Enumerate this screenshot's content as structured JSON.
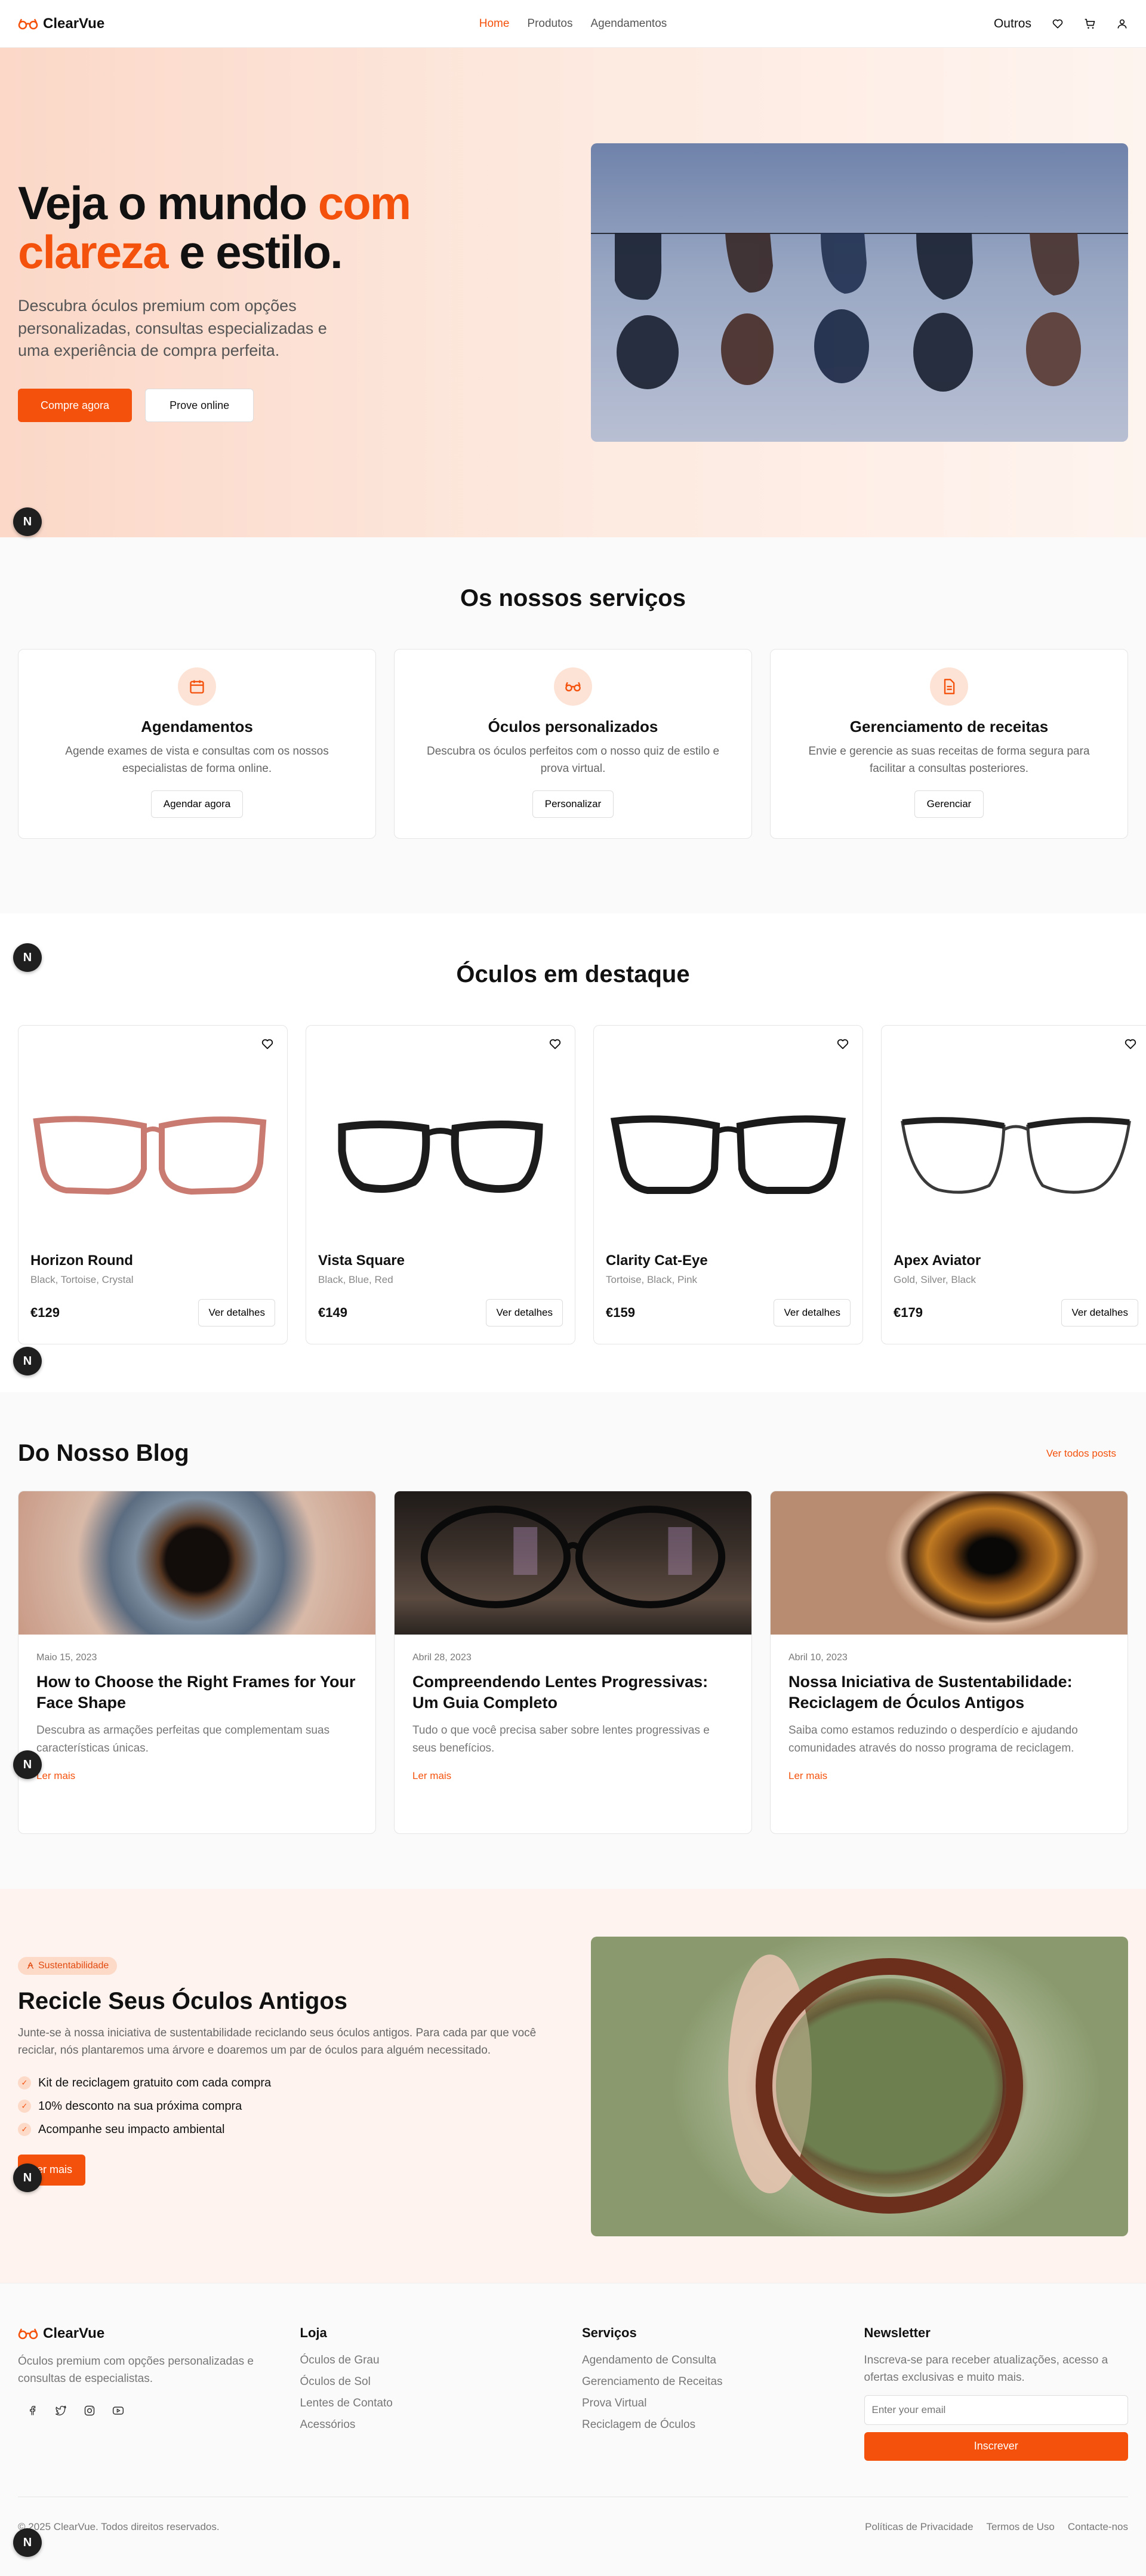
{
  "brand": {
    "name": "ClearVue",
    "accent": "#f4520c"
  },
  "nav": {
    "items": [
      {
        "label": "Home",
        "active": true
      },
      {
        "label": "Produtos",
        "active": false
      },
      {
        "label": "Agendamentos",
        "active": false
      }
    ]
  },
  "header_right": {
    "others_label": "Outros"
  },
  "hero": {
    "title_part1": "Veja o mundo ",
    "title_accent": "com clareza",
    "title_part2": " e estilo.",
    "subtitle": "Descubra óculos premium com opções personalizadas, consultas especializadas e uma experiência de compra perfeita.",
    "primary_btn": "Compre agora",
    "secondary_btn": "Prove online"
  },
  "badge_letter": "N",
  "services": {
    "title": "Os nossos serviços",
    "items": [
      {
        "icon": "calendar-icon",
        "title": "Agendamentos",
        "desc": "Agende exames de vista e consultas com os nossos especialistas de forma online.",
        "btn": "Agendar agora"
      },
      {
        "icon": "glasses-icon",
        "title": "Óculos personalizados",
        "desc": "Descubra os óculos perfeitos com o nosso quiz de estilo e prova virtual.",
        "btn": "Personalizar"
      },
      {
        "icon": "document-icon",
        "title": "Gerenciamento de receitas",
        "desc": "Envie e gerencie as suas receitas de forma segura para facilitar a consultas posteriores.",
        "btn": "Gerenciar"
      }
    ]
  },
  "products": {
    "title": "Óculos em destaque",
    "items": [
      {
        "name": "Horizon Round",
        "colors": "Black, Tortoise, Crystal",
        "price": "€129",
        "btn": "Ver detalhes",
        "frame_color": "#c97b72"
      },
      {
        "name": "Vista Square",
        "colors": "Black, Blue, Red",
        "price": "€149",
        "btn": "Ver detalhes",
        "frame_color": "#1c1c1c"
      },
      {
        "name": "Clarity Cat-Eye",
        "colors": "Tortoise, Black, Pink",
        "price": "€159",
        "btn": "Ver detalhes",
        "frame_color": "#1a1a1a"
      },
      {
        "name": "Apex Aviator",
        "colors": "Gold, Silver, Black",
        "price": "€179",
        "btn": "Ver detalhes",
        "frame_color": "#3a3a3a"
      }
    ]
  },
  "blog": {
    "title": "Do Nosso Blog",
    "all_link": "Ver todos posts",
    "posts": [
      {
        "date": "Maio 15, 2023",
        "title": "How to Choose the Right Frames for Your Face Shape",
        "excerpt": "Descubra as armações perfeitas que complementam suas características únicas.",
        "read": "Ler mais"
      },
      {
        "date": "Abril 28, 2023",
        "title": "Compreendendo Lentes Progressivas: Um Guia Completo",
        "excerpt": "Tudo o que você precisa saber sobre lentes progressivas e seus benefícios.",
        "read": "Ler mais"
      },
      {
        "date": "Abril 10, 2023",
        "title": "Nossa Iniciativa de Sustentabilidade: Reciclagem de Óculos Antigos",
        "excerpt": "Saiba como estamos reduzindo o desperdício e ajudando comunidades através do nosso programa de reciclagem.",
        "read": "Ler mais"
      }
    ]
  },
  "recycle": {
    "tag": "Sustentabilidade",
    "title": "Recicle Seus Óculos Antigos",
    "desc": "Junte-se à nossa iniciativa de sustentabilidade reciclando seus óculos antigos. Para cada par que você reciclar, nós plantaremos uma árvore e doaremos um par de óculos para alguém necessitado.",
    "checks": [
      "Kit de reciclagem gratuito com cada compra",
      "10% desconto na sua próxima compra",
      "Acompanhe seu impacto ambiental"
    ],
    "btn": "Ler mais"
  },
  "footer": {
    "desc": "Óculos premium com opções personalizadas e consultas de especialistas.",
    "socials": [
      "facebook-icon",
      "twitter-icon",
      "instagram-icon",
      "youtube-icon"
    ],
    "shop_title": "Loja",
    "shop_links": [
      "Óculos de Grau",
      "Óculos de Sol",
      "Lentes de Contato",
      "Acessórios"
    ],
    "services_title": "Serviços",
    "services_links": [
      "Agendamento de Consulta",
      "Gerenciamento de Receitas",
      "Prova Virtual",
      "Reciclagem de Óculos"
    ],
    "newsletter_title": "Newsletter",
    "newsletter_desc": "Inscreva-se para receber atualizações, acesso a ofertas exclusivas e muito mais.",
    "newsletter_placeholder": "Enter your email",
    "newsletter_btn": "Inscrever",
    "copyright": "© 2025 ClearVue. Todos direitos reservados.",
    "legal_links": [
      "Políticas de Privacidade",
      "Termos de Uso",
      "Contacte-nos"
    ]
  }
}
